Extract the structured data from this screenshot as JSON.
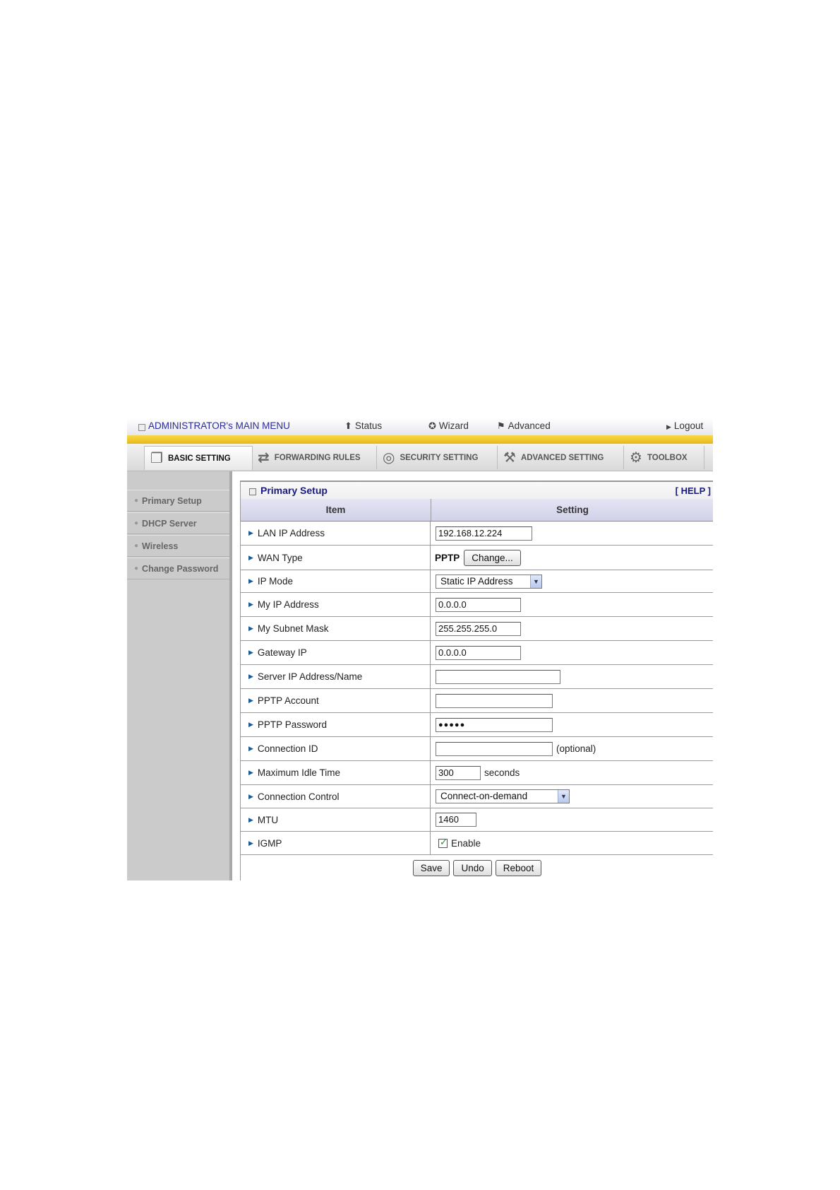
{
  "topbar": {
    "title": "ADMINISTRATOR's MAIN MENU",
    "status": "Status",
    "wizard": "Wizard",
    "advanced": "Advanced",
    "logout": "Logout"
  },
  "tabs": [
    {
      "label": "BASIC SETTING",
      "icon": "folder-icon"
    },
    {
      "label": "FORWARDING RULES",
      "icon": "arrows-icon"
    },
    {
      "label": "SECURITY SETTING",
      "icon": "lock-ring-icon"
    },
    {
      "label": "ADVANCED SETTING",
      "icon": "tools-icon"
    },
    {
      "label": "TOOLBOX",
      "icon": "gear-icon"
    }
  ],
  "sidebar": {
    "items": [
      "Primary Setup",
      "DHCP Server",
      "Wireless",
      "Change Password"
    ]
  },
  "panel": {
    "title": "Primary Setup",
    "help": "[ HELP ]",
    "col_item": "Item",
    "col_setting": "Setting"
  },
  "rows": {
    "lan_ip": {
      "label": "LAN IP Address",
      "value": "192.168.12.224"
    },
    "wan_type": {
      "label": "WAN Type",
      "value": "PPTP",
      "button": "Change..."
    },
    "ip_mode": {
      "label": "IP Mode",
      "value": "Static IP Address"
    },
    "my_ip": {
      "label": "My IP Address",
      "value": "0.0.0.0"
    },
    "subnet": {
      "label": "My Subnet Mask",
      "value": "255.255.255.0"
    },
    "gateway": {
      "label": "Gateway IP",
      "value": "0.0.0.0"
    },
    "server": {
      "label": "Server IP Address/Name",
      "value": ""
    },
    "account": {
      "label": "PPTP Account",
      "value": ""
    },
    "password": {
      "label": "PPTP Password",
      "value": "●●●●●"
    },
    "conn_id": {
      "label": "Connection ID",
      "value": "",
      "hint": "(optional)"
    },
    "idle": {
      "label": "Maximum Idle Time",
      "value": "300",
      "unit": "seconds"
    },
    "control": {
      "label": "Connection Control",
      "value": "Connect-on-demand"
    },
    "mtu": {
      "label": "MTU",
      "value": "1460"
    },
    "igmp": {
      "label": "IGMP",
      "checkbox_label": "Enable",
      "checked": true
    }
  },
  "actions": {
    "save": "Save",
    "undo": "Undo",
    "reboot": "Reboot"
  }
}
